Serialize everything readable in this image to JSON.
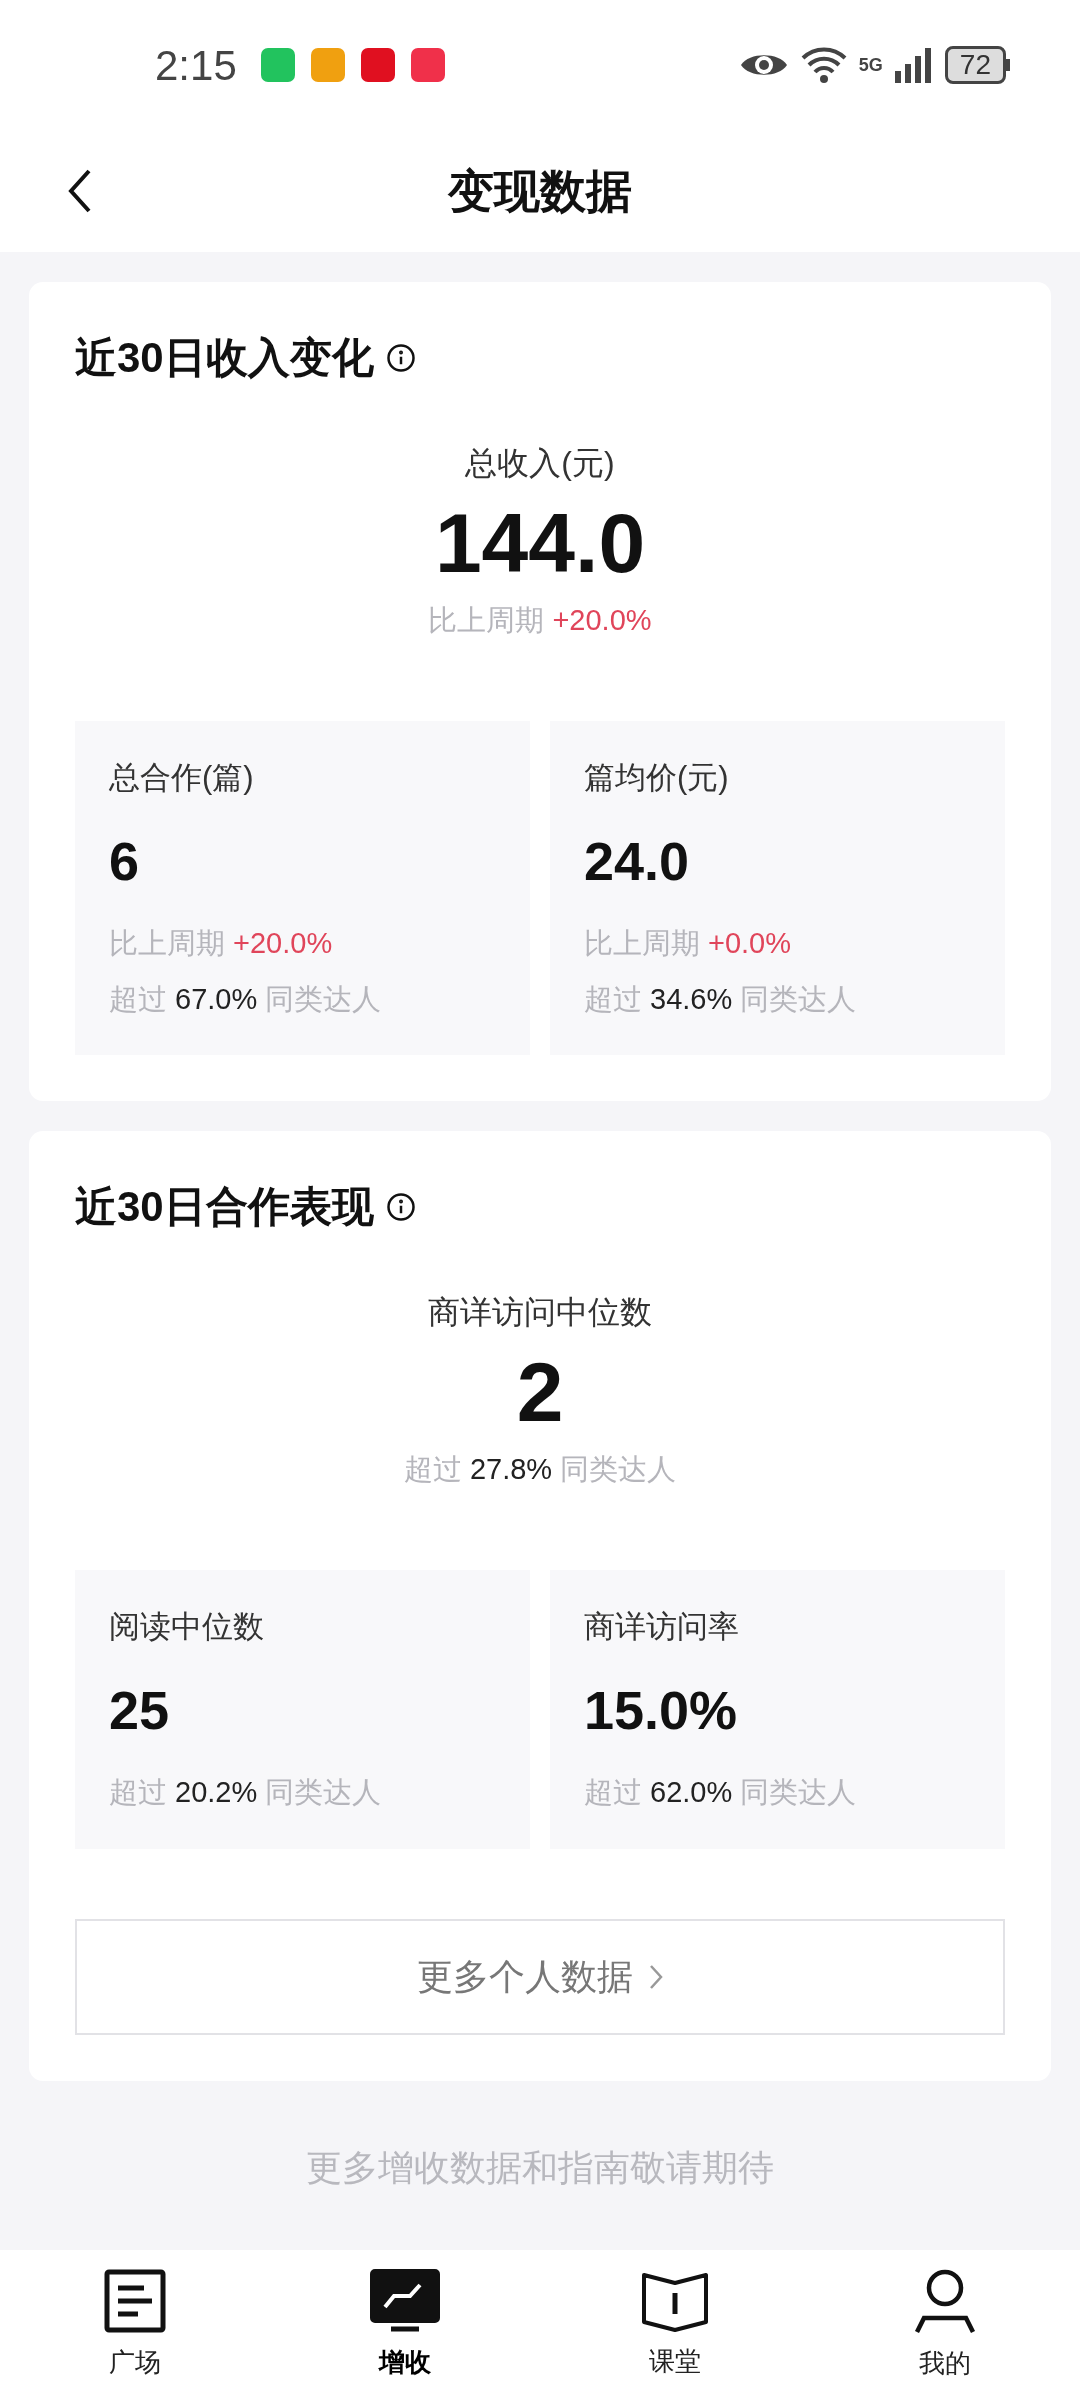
{
  "status_bar": {
    "time": "2:15",
    "network": "5G",
    "battery": "72"
  },
  "header": {
    "title": "变现数据"
  },
  "sections": [
    {
      "title": "近30日收入变化",
      "main": {
        "label": "总收入(元)",
        "value": "144.0",
        "change": {
          "label": "比上周期",
          "value": "+20.0%"
        }
      },
      "stats": [
        {
          "label": "总合作(篇)",
          "value": "6",
          "change": {
            "label": "比上周期",
            "value": "+20.0%"
          },
          "beat": {
            "prefix": "超过",
            "value": "67.0%",
            "suffix": "同类达人"
          }
        },
        {
          "label": "篇均价(元)",
          "value": "24.0",
          "change": {
            "label": "比上周期",
            "value": "+0.0%"
          },
          "beat": {
            "prefix": "超过",
            "value": "34.6%",
            "suffix": "同类达人"
          }
        }
      ]
    },
    {
      "title": "近30日合作表现",
      "main": {
        "label": "商详访问中位数",
        "value": "2",
        "beat": {
          "prefix": "超过",
          "value": "27.8%",
          "suffix": "同类达人"
        }
      },
      "stats": [
        {
          "label": "阅读中位数",
          "value": "25",
          "beat": {
            "prefix": "超过",
            "value": "20.2%",
            "suffix": "同类达人"
          }
        },
        {
          "label": "商详访问率",
          "value": "15.0%",
          "beat": {
            "prefix": "超过",
            "value": "62.0%",
            "suffix": "同类达人"
          }
        }
      ],
      "more_button": "更多个人数据"
    }
  ],
  "footer_note": "更多增收数据和指南敬请期待",
  "nav": [
    {
      "label": "广场",
      "selected": false
    },
    {
      "label": "增收",
      "selected": true
    },
    {
      "label": "课堂",
      "selected": false
    },
    {
      "label": "我的",
      "selected": false
    }
  ]
}
